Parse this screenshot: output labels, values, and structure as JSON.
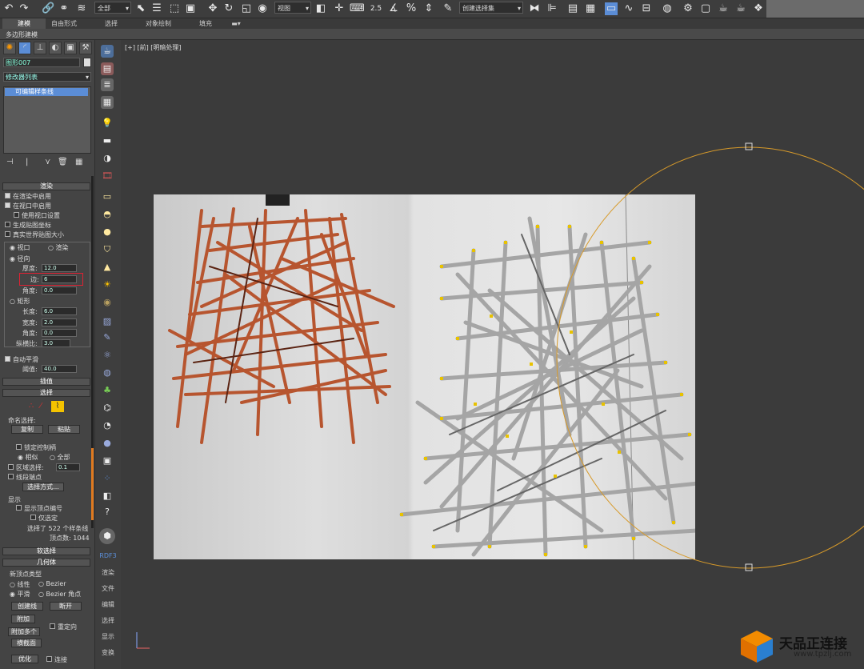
{
  "toolbar": {
    "filter_select": "全部",
    "view_select": "视图",
    "snap_value": "2.5",
    "selection_set": "创建选择集"
  },
  "ribbon": {
    "tabs": [
      "建模",
      "自由形式",
      "选择",
      "对象绘制",
      "填充"
    ],
    "subtitle": "多边形建模"
  },
  "panel": {
    "object_name": "图形007",
    "modifier_list": "修改器列表",
    "stack_item": "可编辑样条线",
    "rendering": {
      "header": "渲染",
      "enable_in_renderer": "在渲染中启用",
      "enable_in_viewport": "在视口中启用",
      "use_viewport_settings": "使用视口设置",
      "gen_mapping": "生成贴图坐标",
      "real_world": "真实世界贴图大小",
      "viewport": "视口",
      "renderer": "渲染",
      "radial": "径向",
      "thickness_label": "厚度:",
      "thickness": "12.0",
      "sides_label": "边:",
      "sides": "6",
      "angle_label": "角度:",
      "angle": "0.0",
      "rectangular": "矩形",
      "length_label": "长度:",
      "length": "6.0",
      "width_label": "宽度:",
      "width": "2.0",
      "angle2_label": "角度:",
      "angle2": "0.0",
      "aspect_label": "纵横比:",
      "aspect": "3.0",
      "auto_smooth": "自动平滑",
      "threshold_label": "阈值:",
      "threshold": "40.0"
    },
    "interpolation": "插值",
    "selection": {
      "header": "选择",
      "named_sel": "命名选择:",
      "copy": "复制",
      "paste": "粘贴",
      "lock_handles": "锁定控制柄",
      "alike": "相似",
      "all": "全部",
      "area_sel": "区域选择:",
      "area_value": "0.1",
      "seg_end": "线段端点",
      "sel_by": "选择方式...",
      "display": "显示",
      "show_vertex_num": "显示顶点编号",
      "only_selected": "仅选定",
      "status1": "选择了 522 个样条线",
      "status2": "顶点数: 1044"
    },
    "soft_selection": "软选择",
    "geometry": {
      "header": "几何体",
      "new_vertex_type": "新顶点类型",
      "linear": "线性",
      "bezier": "Bezier",
      "smooth": "平滑",
      "bezier_corner": "Bezier 角点",
      "create_line": "创建线",
      "break": "断开",
      "attach": "附加",
      "reorient": "重定向",
      "attach_multi": "附加多个",
      "cross_section": "横截面",
      "refine": "优化",
      "connect": "连接"
    }
  },
  "sidebar2": {
    "rdf_label": "RDF3",
    "labels": [
      "渲染",
      "文件",
      "编辑",
      "选择",
      "显示",
      "变换"
    ]
  },
  "viewport": {
    "label": "[+] [前] [明暗处理]"
  },
  "watermark": {
    "title": "天品正连接",
    "url": "www.tpzlj.com"
  },
  "colors": {
    "accent_yellow": "#e8c200",
    "stack_blue": "#5b8dd6",
    "spline_orange": "#d79a2a"
  }
}
